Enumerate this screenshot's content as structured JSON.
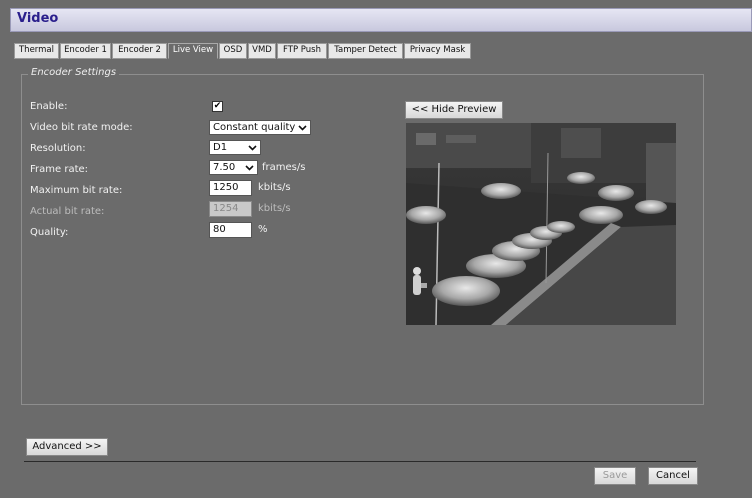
{
  "window": {
    "title": "Video"
  },
  "tabs": [
    "Thermal",
    "Encoder 1",
    "Encoder 2",
    "Live View",
    "OSD",
    "VMD",
    "FTP Push",
    "Tamper Detect",
    "Privacy Mask"
  ],
  "active_tab": "Live View",
  "encoder_settings": {
    "legend": "Encoder Settings",
    "enable": {
      "label": "Enable:",
      "checked": true,
      "mark": "✔"
    },
    "bit_rate_mode": {
      "label": "Video bit rate mode:",
      "value": "Constant quality"
    },
    "resolution": {
      "label": "Resolution:",
      "value": "D1"
    },
    "frame_rate": {
      "label": "Frame rate:",
      "value": "7.50",
      "unit": "frames/s"
    },
    "max_bit_rate": {
      "label": "Maximum bit rate:",
      "value": "1250",
      "unit": "kbits/s"
    },
    "actual_bit_rate": {
      "label": "Actual bit rate:",
      "value": "1254",
      "unit": "kbits/s"
    },
    "quality": {
      "label": "Quality:",
      "value": "80",
      "unit": "%"
    }
  },
  "preview": {
    "hide_button": "<< Hide Preview"
  },
  "buttons": {
    "advanced": "Advanced >>",
    "save": "Save",
    "cancel": "Cancel"
  },
  "icons": {
    "chevron": "chevron-down-icon"
  }
}
